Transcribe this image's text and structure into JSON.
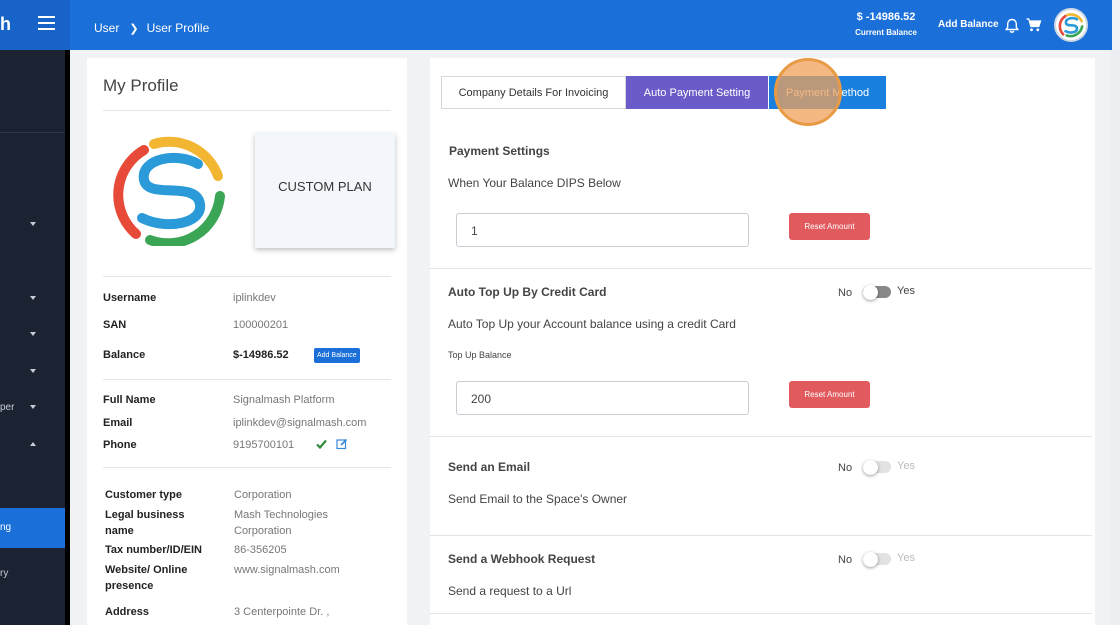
{
  "header": {
    "logo_fragment": "h",
    "breadcrumb": [
      "User",
      "User Profile"
    ],
    "balance_amount": "$ -14986.52",
    "balance_label": "Current Balance",
    "add_balance": "Add Balance"
  },
  "sidebar": {
    "items": [
      {
        "label": ""
      },
      {
        "label": ""
      },
      {
        "label": ""
      },
      {
        "label": ""
      },
      {
        "label": "per"
      },
      {
        "label": ""
      }
    ],
    "active_label": "ng",
    "last_label": "ry"
  },
  "profile": {
    "title": "My Profile",
    "plan": "CUSTOM PLAN",
    "username_label": "Username",
    "username": "iplinkdev",
    "san_label": "SAN",
    "san": "100000201",
    "balance_label": "Balance",
    "balance": "$-14986.52",
    "add_balance_button": "Add Balance",
    "full_name_label": "Full Name",
    "full_name": "Signalmash Platform",
    "email_label": "Email",
    "email": "iplinkdev@signalmash.com",
    "phone_label": "Phone",
    "phone": "9195700101",
    "customer_type_label": "Customer type",
    "customer_type": "Corporation",
    "legal_name_label": "Legal business name",
    "legal_name": "Mash Technologies Corporation",
    "tax_label": "Tax number/ID/EIN",
    "tax": "86-356205",
    "website_label": "Website/ Online presence",
    "website": "www.signalmash.com",
    "address_label": "Address",
    "address": "3 Centerpointe Dr. ,"
  },
  "settings": {
    "tabs": [
      "Company Details For Invoicing",
      "Auto Payment Setting",
      "Payment Method"
    ],
    "payment_settings_title": "Payment Settings",
    "dips_below_label": "When Your Balance DIPS Below",
    "dips_value": "1",
    "reset_amount": "Reset Amount",
    "auto_topup_title": "Auto Top Up By Credit Card",
    "auto_topup_desc": "Auto Top Up your Account balance using a credit Card",
    "topup_balance_label": "Top Up Balance",
    "topup_value": "200",
    "toggle_no": "No",
    "toggle_yes": "Yes",
    "send_email_title": "Send an Email",
    "send_email_desc": "Send Email to the Space's Owner",
    "webhook_title": "Send a Webhook Request",
    "webhook_desc": "Send a request to a Url"
  },
  "colors": {
    "primary": "#1a6fd8",
    "tab_active": "#6a5cc8",
    "reset": "#e05a5e",
    "sidebar": "#1b2332"
  }
}
